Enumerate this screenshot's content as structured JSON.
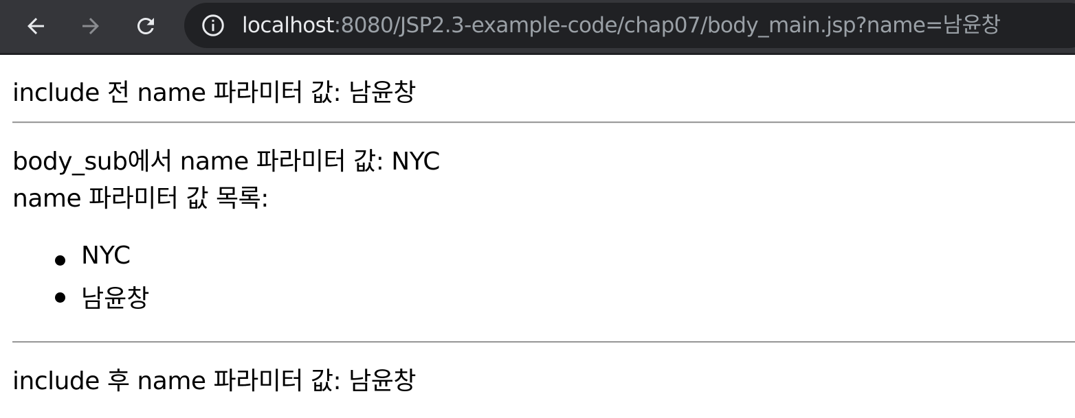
{
  "browser": {
    "url_host": "localhost",
    "url_rest": ":8080/JSP2.3-example-code/chap07/body_main.jsp?name=남윤창",
    "icons": {
      "back": "arrow-left-icon",
      "forward": "arrow-right-icon",
      "reload": "reload-icon",
      "info": "info-icon"
    }
  },
  "page": {
    "before_include": "include 전 name 파라미터 값: 남윤창",
    "sub_param": "body_sub에서 name 파라미터 값: NYC",
    "list_heading": "name 파라미터 값 목록:",
    "values": [
      "NYC",
      "남윤창"
    ],
    "after_include": "include 후 name 파라미터 값: 남윤창"
  }
}
